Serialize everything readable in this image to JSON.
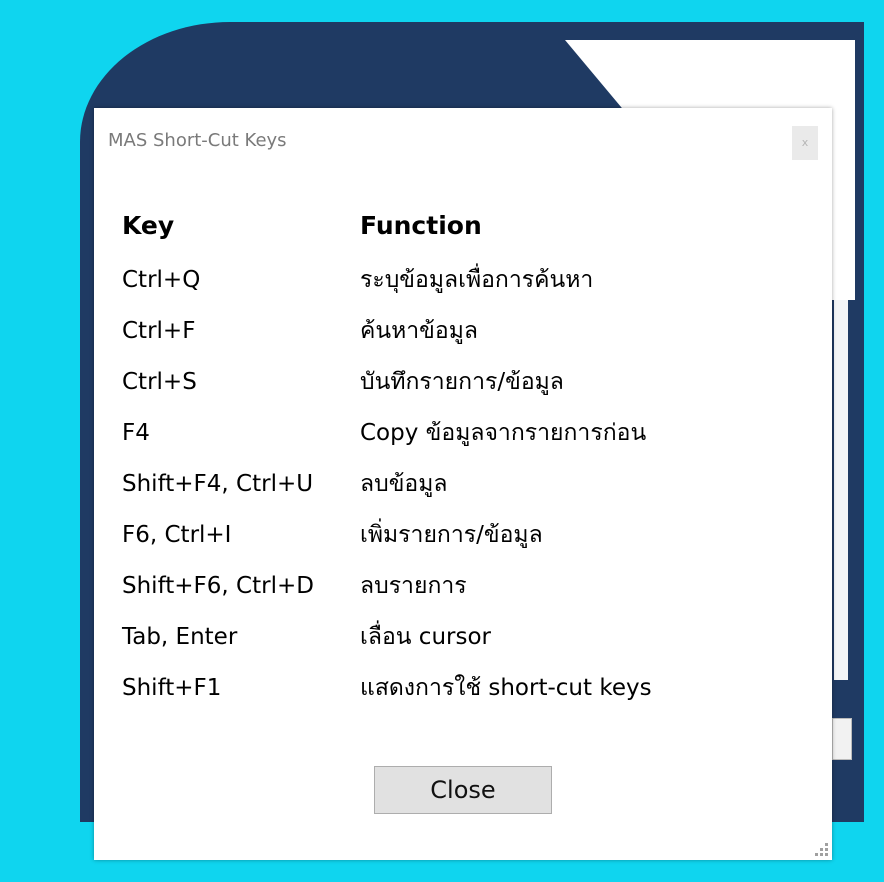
{
  "window": {
    "title": "MAS Short-Cut Keys",
    "close_glyph": "x"
  },
  "table": {
    "header": {
      "key": "Key",
      "function": "Function"
    },
    "rows": [
      {
        "key": "Ctrl+Q",
        "function": "ระบุข้อมูลเพื่อการค้นหา"
      },
      {
        "key": "Ctrl+F",
        "function": "ค้นหาข้อมูล"
      },
      {
        "key": "Ctrl+S",
        "function": "บันทึกรายการ/ข้อมูล"
      },
      {
        "key": "F4",
        "function": "Copy ข้อมูลจากรายการก่อน"
      },
      {
        "key": "Shift+F4, Ctrl+U",
        "function": "ลบข้อมูล"
      },
      {
        "key": "F6, Ctrl+I",
        "function": "เพิ่มรายการ/ข้อมูล"
      },
      {
        "key": "Shift+F6, Ctrl+D",
        "function": "ลบรายการ"
      },
      {
        "key": "Tab, Enter",
        "function": "เลื่อน cursor"
      },
      {
        "key": "Shift+F1",
        "function": "แสดงการใช้ short-cut keys"
      }
    ]
  },
  "buttons": {
    "close_label": "Close"
  },
  "icons": {
    "window_close": "close-icon",
    "resize_grip": "resize-grip-icon"
  },
  "colors": {
    "desktop": "#0fd5ef",
    "background_app": "#1f3a63",
    "dialog": "#ffffff",
    "button": "#e1e1e1"
  }
}
